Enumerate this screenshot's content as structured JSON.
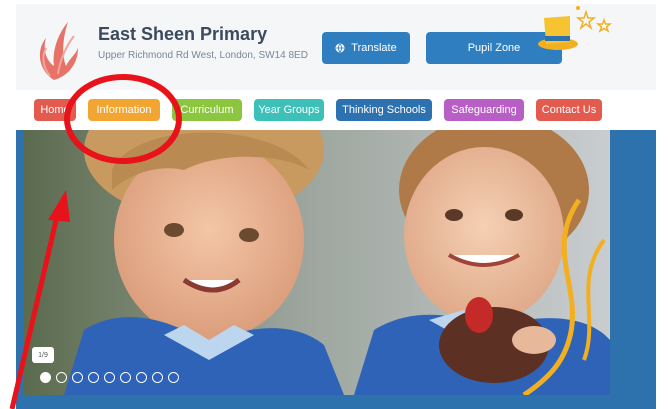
{
  "header": {
    "school_name": "East Sheen Primary",
    "address": "Upper Richmond Rd West, London, SW14 8ED",
    "translate_label": "Translate",
    "pupil_zone_label": "Pupil Zone"
  },
  "nav": {
    "items": [
      {
        "label": "Home",
        "color": "#e35a4f"
      },
      {
        "label": "Information",
        "color": "#f2a530"
      },
      {
        "label": "Curriculum",
        "color": "#8cc63f"
      },
      {
        "label": "Year Groups",
        "color": "#3cc0b8"
      },
      {
        "label": "Thinking Schools",
        "color": "#2d72b0"
      },
      {
        "label": "Safeguarding",
        "color": "#b75fc4"
      },
      {
        "label": "Contact Us",
        "color": "#e35a4f"
      }
    ]
  },
  "hero": {
    "slide_counter": "1/9",
    "slide_count": 9,
    "active_slide": 1
  },
  "colors": {
    "brand_blue": "#2f7fc0",
    "annotation_red": "#e8121b"
  },
  "icons": {
    "translate": "globe-icon",
    "decoration": "top-hat-stars-icon",
    "logo": "flame-logo-icon"
  }
}
